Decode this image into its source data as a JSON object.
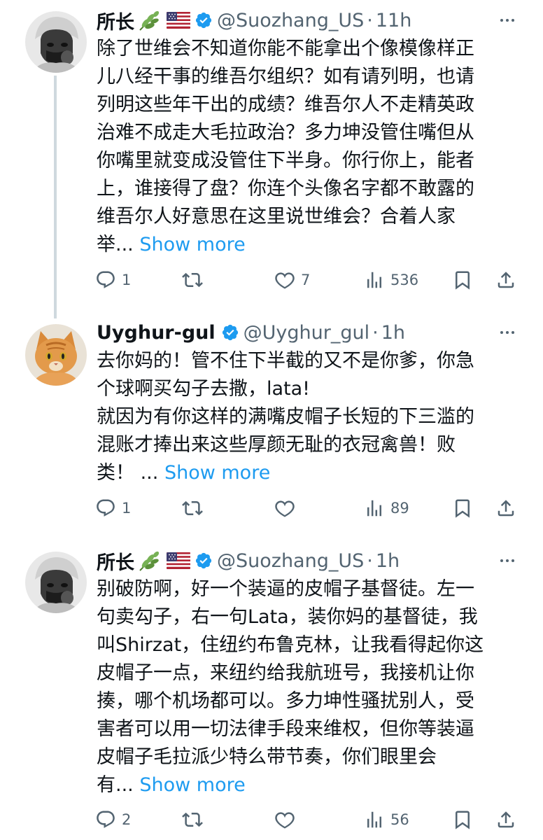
{
  "tweets": [
    {
      "name": "所长",
      "handle": "@Suozhang_US",
      "dot": "·",
      "time": "11h",
      "avatar_icon": "avatar-photo-man-beanie",
      "flag_icon": "us-flag",
      "plant_icon": "herb-emoji",
      "lines": [
        "除了世维会不知道你能不能拿出个像模像样正",
        "儿八经干事的维吾尔组织？如有请列明，也请",
        "列明这些年干出的成绩？维吾尔人不走精英政",
        "治难不成走大毛拉政治？多力坤没管住嘴但从",
        "你嘴里就变成没管住下半身。你行你上，能者",
        "上，谁接得了盘？你连个头像名字都不敢露的",
        "维吾尔人好意思在这里说世维会？合着人家"
      ],
      "last_line": "举...",
      "show_more": "Show more",
      "replies": "1",
      "retweets": "",
      "likes": "7",
      "views": "536"
    },
    {
      "name": "Uyghur-gul",
      "handle": "@Uyghur_gul",
      "dot": "·",
      "time": "1h",
      "avatar_icon": "avatar-photo-orange-cat",
      "lines": [
        "去你妈的！管不住下半截的又不是你爹，你急",
        "个球啊买勾子去撒，lata!",
        "就因为有你这样的满嘴皮帽子长短的下三滥的",
        "混账才捧出来这些厚颜无耻的衣冠禽兽！败"
      ],
      "last_line": "类！ ...",
      "show_more": "Show more",
      "replies": "1",
      "retweets": "",
      "likes": "",
      "views": "89"
    },
    {
      "name": "所长",
      "handle": "@Suozhang_US",
      "dot": "·",
      "time": "1h",
      "avatar_icon": "avatar-photo-man-beanie",
      "flag_icon": "us-flag",
      "plant_icon": "herb-emoji",
      "lines": [
        "别破防啊，好一个装逼的皮帽子基督徒。左一",
        "句卖勾子，右一句Lata，装你妈的基督徒，我",
        "叫Shirzat，住纽约布鲁克林，让我看得起你这",
        "皮帽子一点，来纽约给我航班号，我接机让你",
        "揍，哪个机场都可以。多力坤性骚扰别人，受",
        "害者可以用一切法律手段来维权，但你等装逼",
        "皮帽子毛拉派少特么带节奏，你们眼里会"
      ],
      "last_line": "有...",
      "show_more": "Show more",
      "replies": "2",
      "retweets": "",
      "likes": "",
      "views": "56"
    }
  ],
  "colors": {
    "text": "#0f1419",
    "secondary": "#536471",
    "link": "#1d9bf0",
    "verified": "#1d9bf0",
    "line": "#cfd9de"
  }
}
